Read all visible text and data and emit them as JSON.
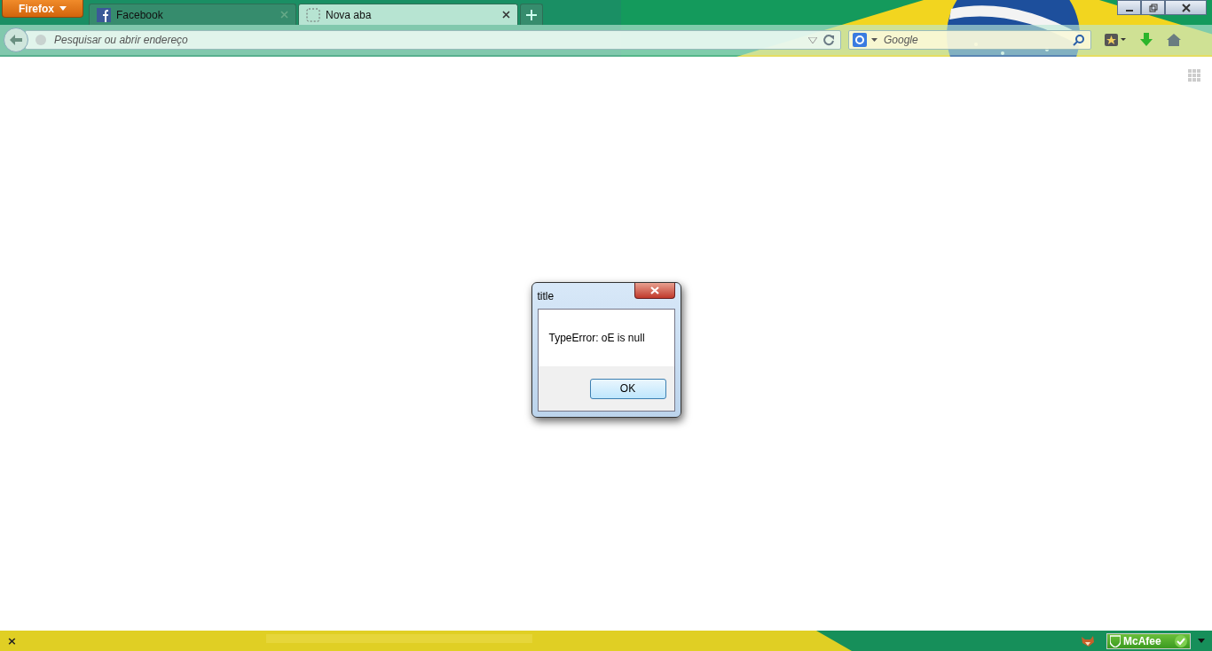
{
  "browser": {
    "menu_button": "Firefox",
    "tabs": [
      {
        "title": "Facebook",
        "selected": false,
        "kind": "site"
      },
      {
        "title": "Nova aba",
        "selected": true,
        "kind": "new"
      }
    ],
    "address_bar": {
      "placeholder": "Pesquisar ou abrir endereço"
    },
    "search_bar": {
      "placeholder": "Google"
    }
  },
  "dialog": {
    "title": "title",
    "message": "TypeError: oE is null",
    "button": "OK"
  },
  "addon_bar": {
    "close": "×",
    "badge": "McAfee"
  }
}
